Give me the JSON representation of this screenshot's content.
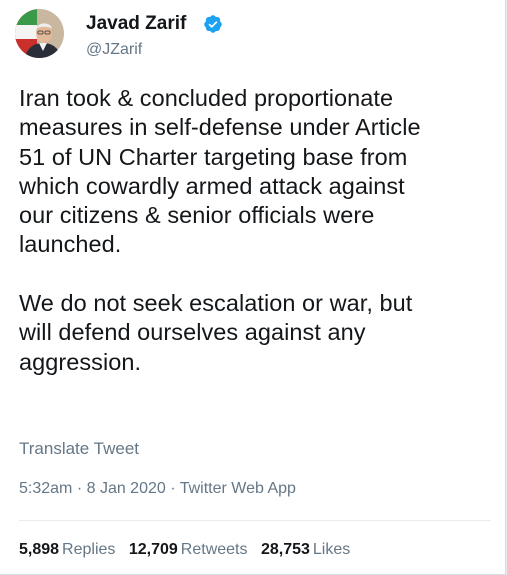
{
  "author": {
    "display_name": "Javad Zarif",
    "handle": "@JZarif",
    "verified_icon": "verified-badge-icon",
    "avatar_icon": "profile-avatar"
  },
  "tweet": {
    "text": "Iran took & concluded proportionate\nmeasures in self-defense under Article\n51 of UN Charter targeting base from\nwhich cowardly armed attack against\nour citizens & senior officials were\nlaunched.\n\nWe do not seek escalation or war, but\nwill defend ourselves against any\naggression.",
    "translate_label": "Translate Tweet",
    "time": "5:32am",
    "separator": " · ",
    "date": "8 Jan 2020",
    "source": "Twitter Web App"
  },
  "stats": {
    "replies_count": "5,898",
    "replies_label": "Replies",
    "retweets_count": "12,709",
    "retweets_label": "Retweets",
    "likes_count": "28,753",
    "likes_label": "Likes"
  },
  "colors": {
    "text": "#14171a",
    "secondary": "#657786",
    "verified": "#1da1f2",
    "divider": "#e6ecf0"
  }
}
